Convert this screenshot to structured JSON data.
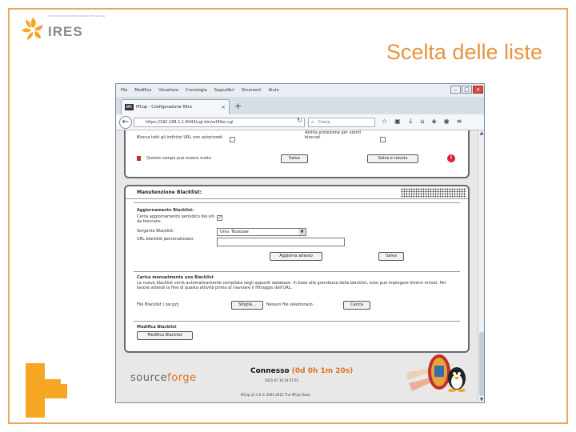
{
  "slide": {
    "title": "Scelta delle liste",
    "logo_small_text": "ISTITUTO DI RICERCHE ECONOMICHE E SOCIALI",
    "logo_brand": "IRES",
    "accent_color": "#e8933e"
  },
  "browser": {
    "menu": [
      "File",
      "Modifica",
      "Visualizza",
      "Cronologia",
      "Segnalibri",
      "Strumenti",
      "Aiuto"
    ],
    "tab_title": "IPCop - Configurazione filtro",
    "tab_favicon_text": "IPC",
    "url": "https://192.168.1.1:8443/cgi-bin/urlfilter.cgi",
    "search_placeholder": "Cerca",
    "window_controls": [
      "minimize-icon",
      "maximize-icon",
      "close-icon"
    ]
  },
  "panel_top": {
    "check1_label": "Blocca tutti gli indirizzi URL non autorizzati",
    "check2_label": "Abilita protezione per utenti bloccati",
    "note": "Questo campo può essere vuoto",
    "save_label": "Salva",
    "save_restart_label": "Salva e riavvia"
  },
  "panel_blacklist": {
    "title": "Manutenzione Blacklist:",
    "update_section": "Aggiornamento Blacklist:",
    "auto_update_label": "Cerca aggiornamento periodico dei siti da bloccare:",
    "source_label": "Sorgente Blacklist:",
    "source_value": "Univ. Toulouse",
    "custom_label": "URL blacklist personalizzato:",
    "update_now_label": "Aggiorna adesso",
    "save_label": "Salva",
    "manual_section": "Carica manualmente una Blacklist",
    "manual_desc": "La nuova blacklist verrà automaticamente compilata negli appositi database. In base alla grandezza della blacklist, esso può impiegare diversi minuti. Per favore attendi la fine di questa attività prima di riavviare il filtraggio dell'URL.",
    "file_label": "File Blacklist (.tar.gz):",
    "browse_label": "Sfoglia...",
    "no_file_label": "Nessun file selezionato.",
    "upload_label": "Carica",
    "edit_section": "Modifica Blacklist",
    "edit_button_label": "Modifica Blacklist"
  },
  "footer": {
    "logo_source": "source",
    "logo_forge": "forge",
    "status_prefix": "Connesso",
    "status_time": "(0d 0h 1m 20s)",
    "status_sub": "2015 07 16 14:57:01",
    "copyright": "IPCop v2.1.9 © 2001-2015 The IPCop Team"
  }
}
